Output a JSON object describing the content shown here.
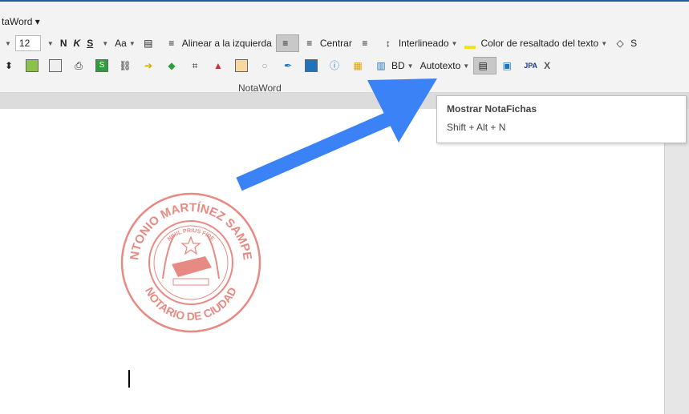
{
  "app": {
    "title_menu": "taWord ▾"
  },
  "toolbar_row1": {
    "font_size": "12",
    "bold": "N",
    "italic": "K",
    "underline": "S",
    "case": "Aa",
    "align_left": "Alinear a la izquierda",
    "center": "Centrar",
    "line_spacing": "Interlineado",
    "highlight": "Color de resaltado del texto",
    "overflow": "S"
  },
  "toolbar_row2": {
    "bd": "BD",
    "autotexto": "Autotexto",
    "jpa": "JPA",
    "close": "X"
  },
  "group": {
    "label": "NotaWord"
  },
  "tooltip": {
    "title": "Mostrar NotaFichas",
    "shortcut": "Shift + Alt + N"
  },
  "seal": {
    "name": "ANTONIO MARTÍNEZ SAMPER",
    "role": "NOTARIO DE CIUDAD",
    "motto": "NIHIL PRIUS FIDE",
    "color": "#e88a84"
  },
  "colors": {
    "accent": "#2b579a",
    "arrow": "#3b82f6",
    "highlight": "#f7e21a"
  }
}
